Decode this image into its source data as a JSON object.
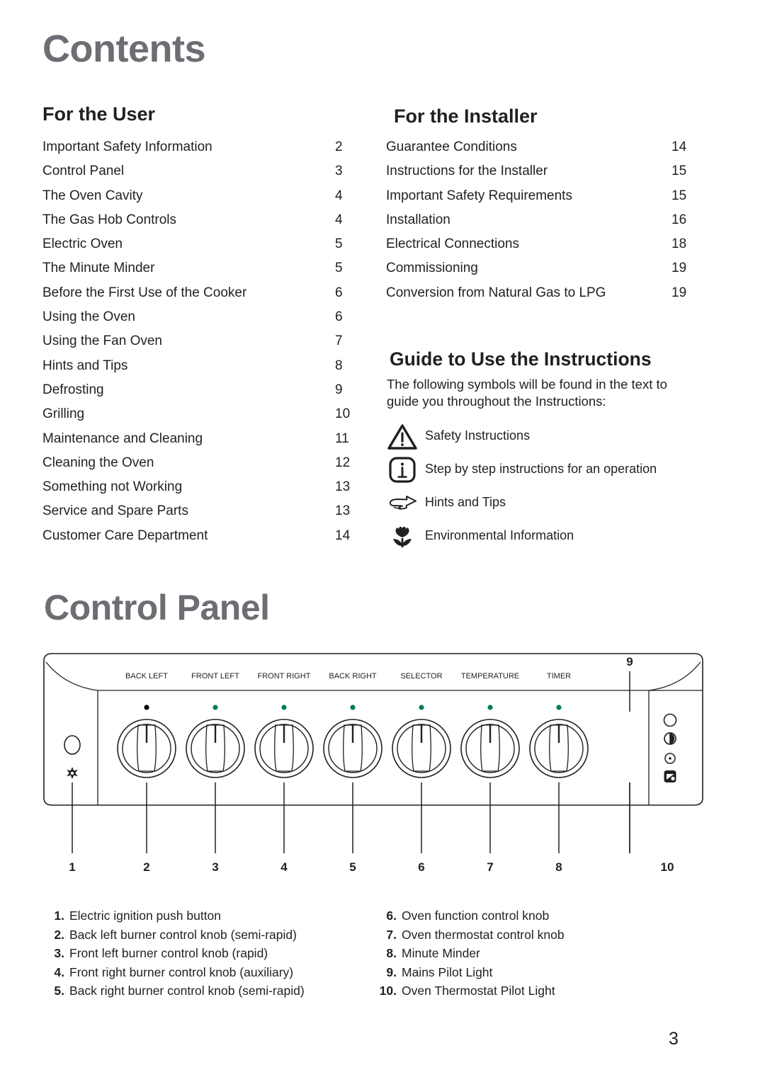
{
  "headings": {
    "contents": "Contents",
    "control_panel": "Control Panel",
    "for_the_user": "For the User",
    "for_the_installer": "For the Installer",
    "guide": "Guide to Use the Instructions"
  },
  "toc_user": [
    {
      "title": "Important Safety Information",
      "page": "2"
    },
    {
      "title": "Control Panel",
      "page": "3"
    },
    {
      "title": "The Oven Cavity",
      "page": "4"
    },
    {
      "title": "The Gas Hob Controls",
      "page": "4"
    },
    {
      "title": "Electric Oven",
      "page": "5"
    },
    {
      "title": "The Minute Minder",
      "page": "5"
    },
    {
      "title": "Before the First Use of the Cooker",
      "page": "6"
    },
    {
      "title": "Using the Oven",
      "page": "6"
    },
    {
      "title": "Using the Fan Oven",
      "page": "7"
    },
    {
      "title": "Hints and Tips",
      "page": "8"
    },
    {
      "title": "Defrosting",
      "page": "9"
    },
    {
      "title": "Grilling",
      "page": "10"
    },
    {
      "title": "Maintenance and Cleaning",
      "page": "11"
    },
    {
      "title": "Cleaning the Oven",
      "page": "12"
    },
    {
      "title": "Something not Working",
      "page": "13"
    },
    {
      "title": "Service and Spare Parts",
      "page": "13"
    },
    {
      "title": "Customer Care Department",
      "page": "14"
    }
  ],
  "toc_installer": [
    {
      "title": "Guarantee Conditions",
      "page": "14"
    },
    {
      "title": "Instructions for the Installer",
      "page": "15"
    },
    {
      "title": "Important Safety Requirements",
      "page": "15"
    },
    {
      "title": "Installation",
      "page": "16"
    },
    {
      "title": "Electrical Connections",
      "page": "18"
    },
    {
      "title": "Commissioning",
      "page": "19"
    },
    {
      "title": "Conversion from Natural Gas to LPG",
      "page": "19"
    }
  ],
  "guide": {
    "intro": "The following symbols will be found in the text to guide you throughout the Instructions:",
    "symbols": [
      {
        "icon": "warning-triangle-icon",
        "label": "Safety Instructions"
      },
      {
        "icon": "info-box-icon",
        "label": "Step by step instructions for an  operation"
      },
      {
        "icon": "pointing-hand-icon",
        "label": "Hints and Tips"
      },
      {
        "icon": "tulip-flower-icon",
        "label": "Environmental Information"
      }
    ]
  },
  "panel": {
    "knob_labels": [
      "BACK LEFT",
      "FRONT LEFT",
      "FRONT RIGHT",
      "BACK RIGHT",
      "SELECTOR",
      "TEMPERATURE",
      "TIMER"
    ],
    "knob_dot_colors": [
      "#000000",
      "#00804a",
      "#00804a",
      "#00804a",
      "#00804a",
      "#00804a",
      "#00804a"
    ],
    "callout_numbers_bottom": [
      "1",
      "2",
      "3",
      "4",
      "5",
      "6",
      "7",
      "8",
      "10"
    ],
    "callout_number_top": "9",
    "ignition_icon": "spark-star-icon",
    "pilot_light_icons": [
      "mains-power-icon",
      "oven-thermostat-icon"
    ]
  },
  "legend_left": [
    {
      "num": "1.",
      "text": "Electric ignition push button"
    },
    {
      "num": "2.",
      "text": "Back left burner control knob (semi-rapid)"
    },
    {
      "num": "3.",
      "text": "Front left burner control knob (rapid)"
    },
    {
      "num": "4.",
      "text": "Front right burner control knob (auxiliary)"
    },
    {
      "num": "5.",
      "text": "Back right burner control knob (semi-rapid)"
    }
  ],
  "legend_right": [
    {
      "num": "6.",
      "text": "Oven function control knob"
    },
    {
      "num": "7.",
      "text": "Oven thermostat control knob"
    },
    {
      "num": "8.",
      "text": "Minute Minder"
    },
    {
      "num": "9.",
      "text": "Mains Pilot Light"
    },
    {
      "num": "10.",
      "text": "Oven Thermostat Pilot Light"
    }
  ],
  "page_number": "3",
  "colors": {
    "heading_gray": "#6d6d73",
    "body_black": "#231f20",
    "pilot_green": "#00804a"
  }
}
